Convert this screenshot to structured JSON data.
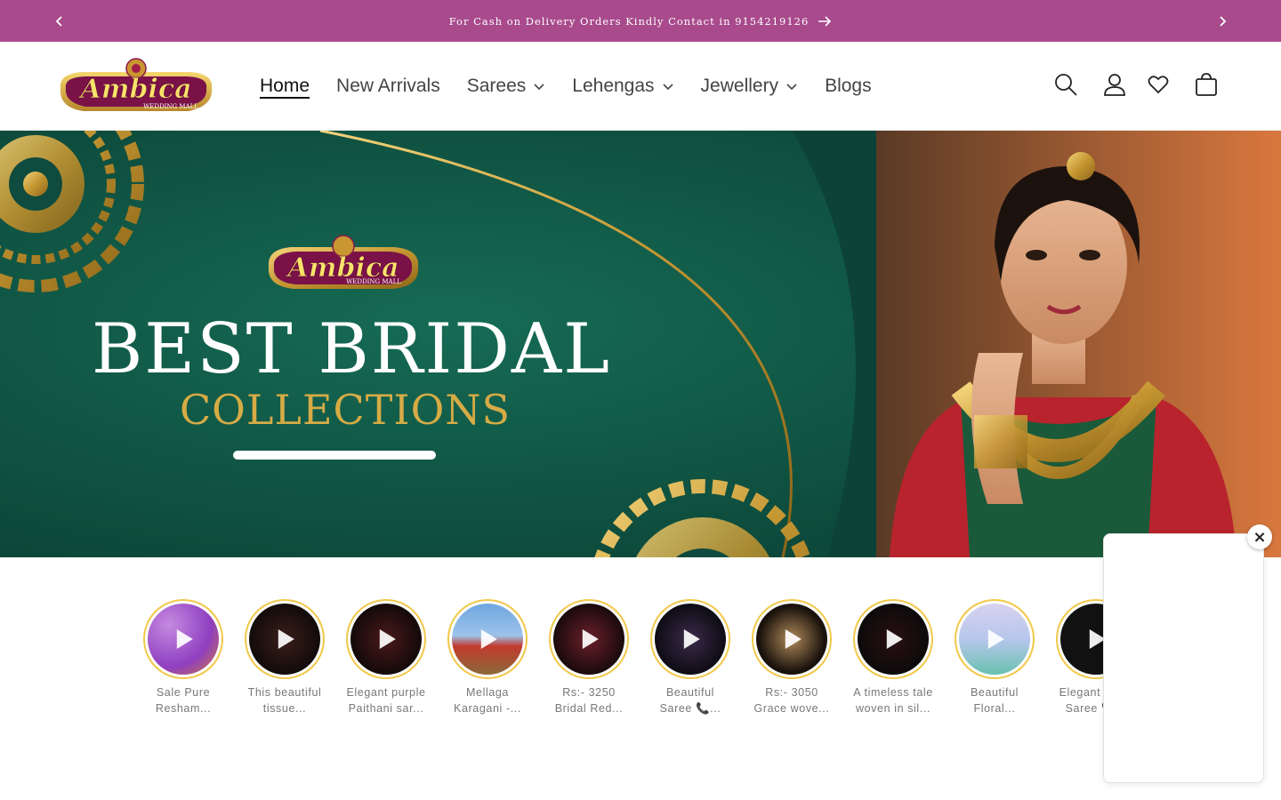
{
  "announcement": {
    "text": "For Cash on Delivery Orders Kindly Contact in 9154219126",
    "prev_icon": "chevron-left-icon",
    "next_icon": "chevron-right-icon",
    "link_icon": "arrow-right-icon"
  },
  "header": {
    "logo": {
      "title": "Ambica",
      "subtitle": "WEDDING MALL"
    },
    "nav": [
      {
        "label": "Home",
        "active": true,
        "dropdown": false
      },
      {
        "label": "New Arrivals",
        "active": false,
        "dropdown": false
      },
      {
        "label": "Sarees",
        "active": false,
        "dropdown": true
      },
      {
        "label": "Lehengas",
        "active": false,
        "dropdown": true
      },
      {
        "label": "Jewellery",
        "active": false,
        "dropdown": true
      },
      {
        "label": "Blogs",
        "active": false,
        "dropdown": false
      }
    ],
    "icons": [
      "search-icon",
      "account-icon",
      "wishlist-heart-icon",
      "cart-icon"
    ]
  },
  "hero": {
    "logo_title": "Ambica",
    "logo_subtitle": "WEDDING MALL",
    "headline": "BEST BRIDAL",
    "subheadline": "COLLECTIONS"
  },
  "stories": [
    {
      "caption_line1": "Sale Pure",
      "caption_line2": "Resham..."
    },
    {
      "caption_line1": "This beautiful",
      "caption_line2": "tissue..."
    },
    {
      "caption_line1": "Elegant purple",
      "caption_line2": "Paithani sar..."
    },
    {
      "caption_line1": "Mellaga",
      "caption_line2": "Karagani -..."
    },
    {
      "caption_line1": "Rs:- 3250",
      "caption_line2": "Bridal Red..."
    },
    {
      "caption_line1": "Beautiful",
      "caption_line2": "Saree 📞..."
    },
    {
      "caption_line1": "Rs:- 3050",
      "caption_line2": "Grace wove..."
    },
    {
      "caption_line1": "A timeless tale",
      "caption_line2": "woven in sil..."
    },
    {
      "caption_line1": "Beautiful",
      "caption_line2": "Floral..."
    },
    {
      "caption_line1": "Elegant Pattu",
      "caption_line2": "Saree 📞..."
    }
  ],
  "widget": {
    "close_label": "×"
  },
  "colors": {
    "announcement_bg": "#a84a8c",
    "hero_green": "#0f4b3e",
    "story_ring": "#f1c84b",
    "gold": "#d4a93a"
  }
}
